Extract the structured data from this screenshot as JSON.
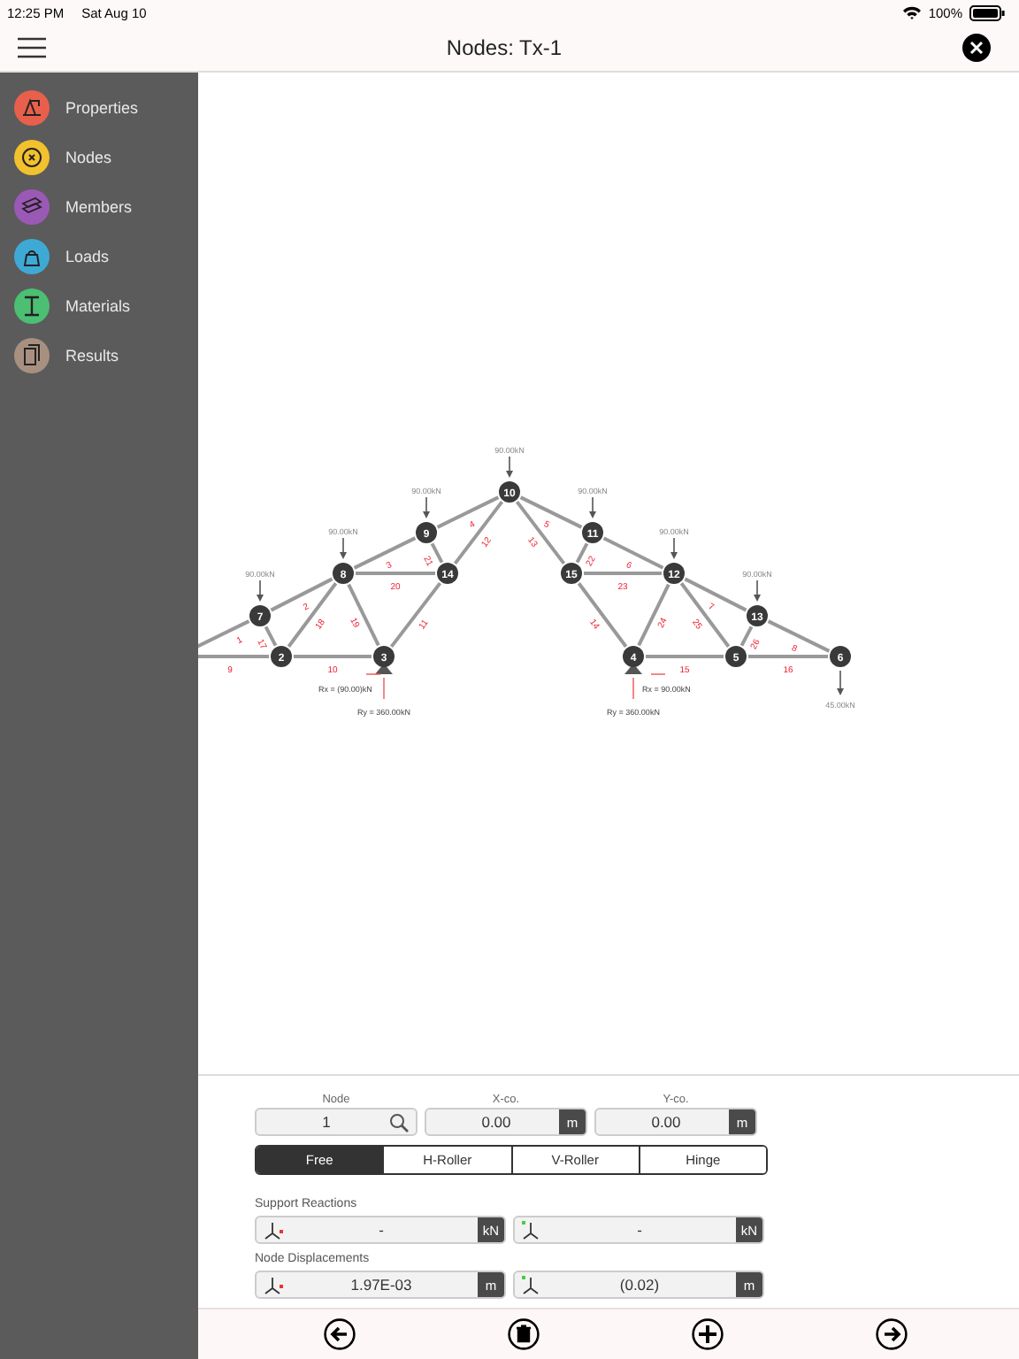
{
  "status_bar": {
    "time": "12:25 PM",
    "date": "Sat Aug 10",
    "battery": "100%"
  },
  "nav": {
    "title": "Nodes: Tx-1"
  },
  "sidebar": {
    "items": [
      {
        "label": "Properties",
        "color": "#e8604c"
      },
      {
        "label": "Nodes",
        "color": "#f2c12e"
      },
      {
        "label": "Members",
        "color": "#9b59b6"
      },
      {
        "label": "Loads",
        "color": "#3fa9d6"
      },
      {
        "label": "Materials",
        "color": "#4cbf72"
      },
      {
        "label": "Results",
        "color": "#a89080"
      }
    ]
  },
  "truss": {
    "nodes": [
      {
        "label": "2"
      },
      {
        "label": "3"
      },
      {
        "label": "4"
      },
      {
        "label": "5"
      },
      {
        "label": "6"
      },
      {
        "label": "7"
      },
      {
        "label": "8"
      },
      {
        "label": "9"
      },
      {
        "label": "10"
      },
      {
        "label": "11"
      },
      {
        "label": "12"
      },
      {
        "label": "13"
      },
      {
        "label": "14"
      },
      {
        "label": "15"
      }
    ],
    "members": [
      {
        "label": "1"
      },
      {
        "label": "9"
      },
      {
        "label": "10"
      },
      {
        "label": "17"
      },
      {
        "label": "18"
      },
      {
        "label": "2"
      },
      {
        "label": "19"
      },
      {
        "label": "20"
      },
      {
        "label": "3"
      },
      {
        "label": "21"
      },
      {
        "label": "4"
      },
      {
        "label": "12"
      },
      {
        "label": "11"
      },
      {
        "label": "13"
      },
      {
        "label": "5"
      },
      {
        "label": "22"
      },
      {
        "label": "23"
      },
      {
        "label": "6"
      },
      {
        "label": "14"
      },
      {
        "label": "24"
      },
      {
        "label": "7"
      },
      {
        "label": "25"
      },
      {
        "label": "15"
      },
      {
        "label": "26"
      },
      {
        "label": "16"
      },
      {
        "label": "8"
      }
    ],
    "loads": [
      {
        "value": "90.00kN"
      },
      {
        "value": "90.00kN"
      },
      {
        "value": "90.00kN"
      },
      {
        "value": "90.00kN"
      },
      {
        "value": "90.00kN"
      },
      {
        "value": "90.00kN"
      },
      {
        "value": "90.00kN"
      },
      {
        "value": "45.00kN"
      }
    ],
    "reactions": [
      {
        "text": "Rx = (90.00)kN"
      },
      {
        "text": "Ry = 360.00kN"
      },
      {
        "text": "Rx = 90.00kN"
      },
      {
        "text": "Ry = 360.00kN"
      }
    ]
  },
  "form": {
    "node": {
      "label": "Node",
      "value": "1"
    },
    "x": {
      "label": "X-co.",
      "value": "0.00",
      "unit": "m"
    },
    "y": {
      "label": "Y-co.",
      "value": "0.00",
      "unit": "m"
    },
    "supports": [
      {
        "label": "Free",
        "selected": true
      },
      {
        "label": "H-Roller",
        "selected": false
      },
      {
        "label": "V-Roller",
        "selected": false
      },
      {
        "label": "Hinge",
        "selected": false
      }
    ],
    "reactions_label": "Support Reactions",
    "reactions": [
      {
        "value": "-",
        "unit": "kN"
      },
      {
        "value": "-",
        "unit": "kN"
      }
    ],
    "displacements_label": "Node Displacements",
    "displacements": [
      {
        "value": "1.97E-03",
        "unit": "m"
      },
      {
        "value": "(0.02)",
        "unit": "m"
      }
    ]
  }
}
